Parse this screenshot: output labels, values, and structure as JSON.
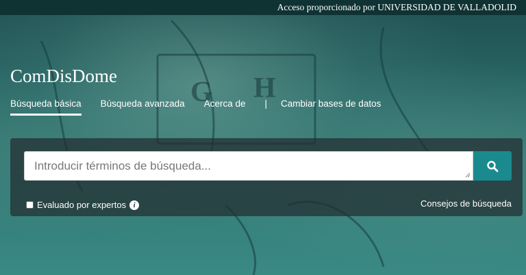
{
  "topbar": {
    "access_text": "Acceso proporcionado por UNIVERSIDAD DE VALLADOLID"
  },
  "brand": {
    "title": "ComDisDome"
  },
  "nav": {
    "items": [
      {
        "label": "Búsqueda básica",
        "active": true
      },
      {
        "label": "Búsqueda avanzada",
        "active": false
      },
      {
        "label": "Acerca de",
        "active": false
      }
    ],
    "separator": "|",
    "change_db_label": "Cambiar bases de datos"
  },
  "search": {
    "placeholder": "Introducir términos de búsqueda...",
    "button_icon": "search-icon",
    "peer_reviewed_label": "Evaluado por expertos",
    "peer_reviewed_checked": false,
    "info_icon": "info-icon",
    "tips_label": "Consejos de búsqueda"
  },
  "colors": {
    "topbar_bg": "#0f3233",
    "accent": "#1b8a8f"
  }
}
